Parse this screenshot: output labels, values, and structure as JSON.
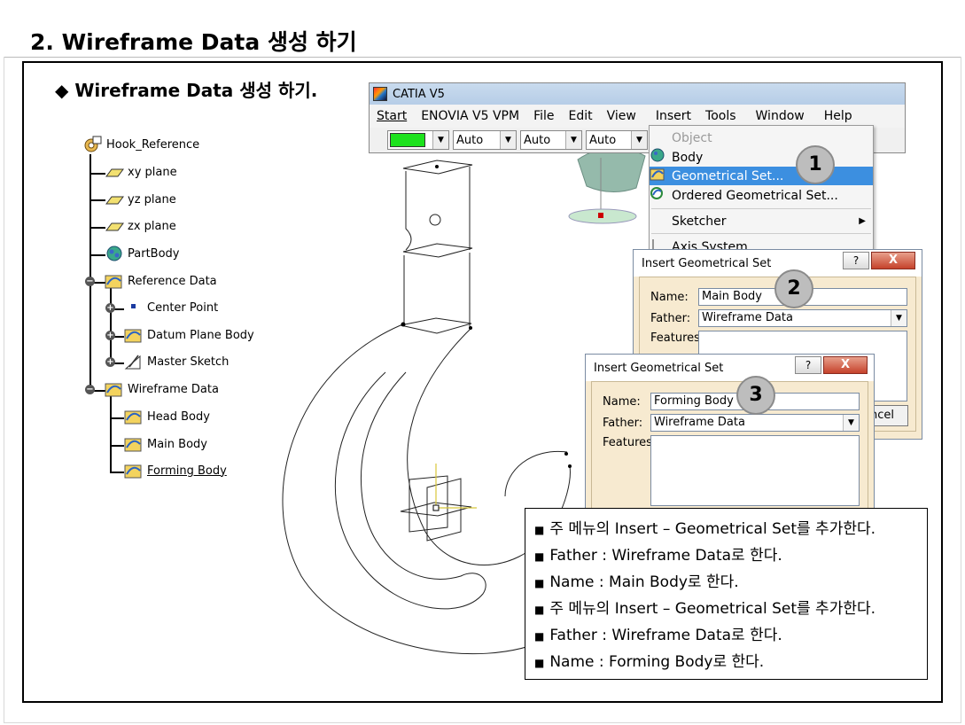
{
  "slide": {
    "title": "2. Wireframe Data 생성 하기",
    "subtitle": "Wireframe Data 생성 하기.",
    "subtitle_bullet": "◆"
  },
  "spec_tree": {
    "root": "Hook_Reference",
    "items": [
      {
        "label": "xy plane"
      },
      {
        "label": "yz plane"
      },
      {
        "label": "zx plane"
      },
      {
        "label": "PartBody"
      },
      {
        "label": "Reference Data"
      },
      {
        "label": "Center Point"
      },
      {
        "label": "Datum Plane Body"
      },
      {
        "label": "Master Sketch"
      },
      {
        "label": "Wireframe Data"
      },
      {
        "label": "Head Body"
      },
      {
        "label": "Main Body"
      },
      {
        "label": "Forming Body"
      }
    ]
  },
  "catia_window": {
    "title": "CATIA V5",
    "menus": [
      "Start",
      "ENOVIA V5 VPM",
      "File",
      "Edit",
      "View",
      "Insert",
      "Tools",
      "Window",
      "Help"
    ],
    "toolbar": {
      "color": "#1de21d",
      "combos": [
        "Auto",
        "Auto",
        "Auto"
      ]
    }
  },
  "insert_menu": {
    "items": [
      "Object",
      "Body",
      "Geometrical Set...",
      "Ordered Geometrical Set...",
      "Sketcher",
      "Axis System..."
    ],
    "highlighted": "Geometrical Set..."
  },
  "step_badges": [
    "1",
    "2",
    "3"
  ],
  "dialog1": {
    "title": "Insert Geometrical Set",
    "help_label": "?",
    "close_label": "X",
    "name_label": "Name:",
    "name_value": "Main Body",
    "father_label": "Father:",
    "father_value": "Wireframe Data",
    "features_label": "Features:",
    "cancel_partial": "ncel"
  },
  "dialog2": {
    "title": "Insert Geometrical Set",
    "help_label": "?",
    "close_label": "X",
    "name_label": "Name:",
    "name_value": "Forming Body",
    "father_label": "Father:",
    "father_value": "Wireframe Data",
    "features_label": "Features:"
  },
  "notes": {
    "bullet": "■",
    "lines": [
      "주 메뉴의 Insert – Geometrical Set를 추가한다.",
      "Father : Wireframe Data로 한다.",
      "Name : Main Body로 한다.",
      "주 메뉴의 Insert – Geometrical Set를 추가한다.",
      "Father : Wireframe Data로 한다.",
      "Name : Forming Body로 한다."
    ]
  },
  "colors": {
    "menu_highlight": "#3c8fe0",
    "dialog_bg": "#f7ead0",
    "close_button": "#c5422b"
  }
}
